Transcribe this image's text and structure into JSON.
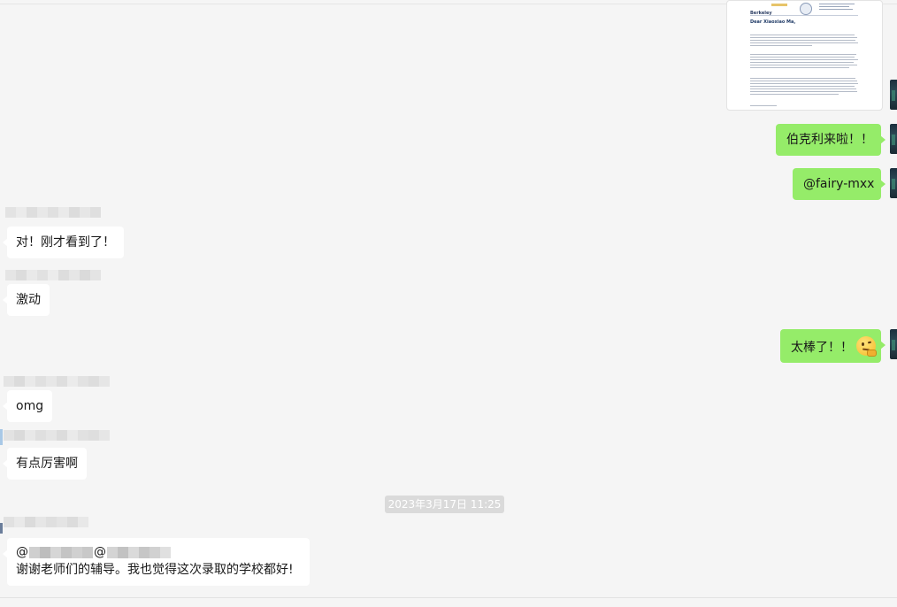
{
  "doc_card": {
    "logo_text": "Berkeley",
    "greeting": "Dear  Xiaoxiao Ma,"
  },
  "messages": {
    "out_1": "伯克利来啦！！",
    "out_2": "@fairy-mxx",
    "out_3": "太棒了！！",
    "in_1": "对！刚才看到了！",
    "in_2": "激动",
    "in_3": "omg",
    "in_4": "有点厉害啊",
    "in_5_at": "@",
    "in_5_at2": "@",
    "in_5_text": "谢谢老师们的辅导。我也觉得这次录取的学校都好!"
  },
  "timestamp": "2023年3月17日 11:25",
  "icons": {
    "emoji": "thinking-face-icon"
  },
  "colors": {
    "outgoing_bubble": "#95ec69",
    "incoming_bubble": "#ffffff",
    "background": "#f5f5f5",
    "timestamp_bg": "#dadada"
  }
}
